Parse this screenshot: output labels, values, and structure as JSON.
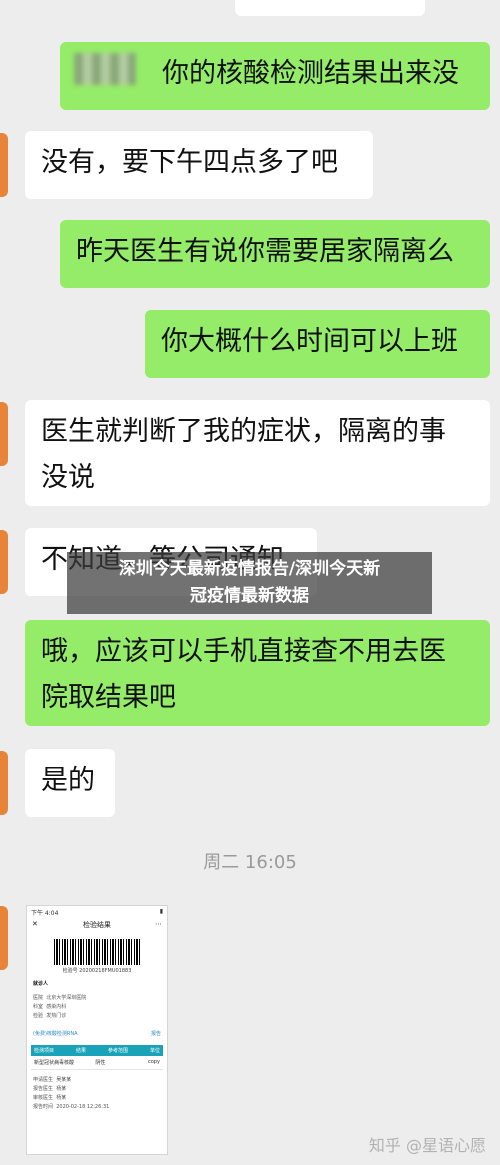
{
  "messages": [
    {
      "side": "right",
      "text": "你的核酸检测结果出来没"
    },
    {
      "side": "left",
      "text": "没有，要下午四点多了吧"
    },
    {
      "side": "right",
      "text": "昨天医生有说你需要居家隔离么"
    },
    {
      "side": "right",
      "text": "你大概什么时间可以上班"
    },
    {
      "side": "left",
      "line1": "医生就判断了我的症状，隔离的事",
      "line2": "没说"
    },
    {
      "side": "left",
      "text": "不知道，等公司通知"
    },
    {
      "side": "right",
      "line1": "哦，应该可以手机直接查不用去医",
      "line2": "院取结果吧"
    },
    {
      "side": "left",
      "text": "是的"
    }
  ],
  "timestamp": "周二 16:05",
  "overlay": {
    "line1": "深圳今天最新疫情报告/深圳今天新",
    "line2": "冠疫情最新数据"
  },
  "image_card": {
    "status_time": "下午 4:04",
    "title": "检验结果",
    "barcode_number": "检验号 20200218FMU01883",
    "patient_label": "就诊人",
    "rows": [
      {
        "label": "医院",
        "value": "北京大学深圳医院"
      },
      {
        "label": "科室",
        "value": "感染内科"
      },
      {
        "label": "检验",
        "value": "发热门诊"
      }
    ],
    "link_text": "(免费)核酸检测RNA",
    "link_action": "报告",
    "table_headers": [
      "检测项目",
      "结果",
      "参考范围",
      "单位"
    ],
    "table_rows": [
      [
        "新型冠状病毒核酸",
        "阴性",
        "",
        "copy"
      ]
    ],
    "footer_rows": [
      {
        "label": "申请医生",
        "value": "吴某某"
      },
      {
        "label": "报告医生",
        "value": "杨某"
      },
      {
        "label": "审核医生",
        "value": "杨某"
      },
      {
        "label": "报告时间",
        "value": "2020-02-18 12:26:31"
      }
    ]
  },
  "watermark": "知乎 @星语心愿"
}
